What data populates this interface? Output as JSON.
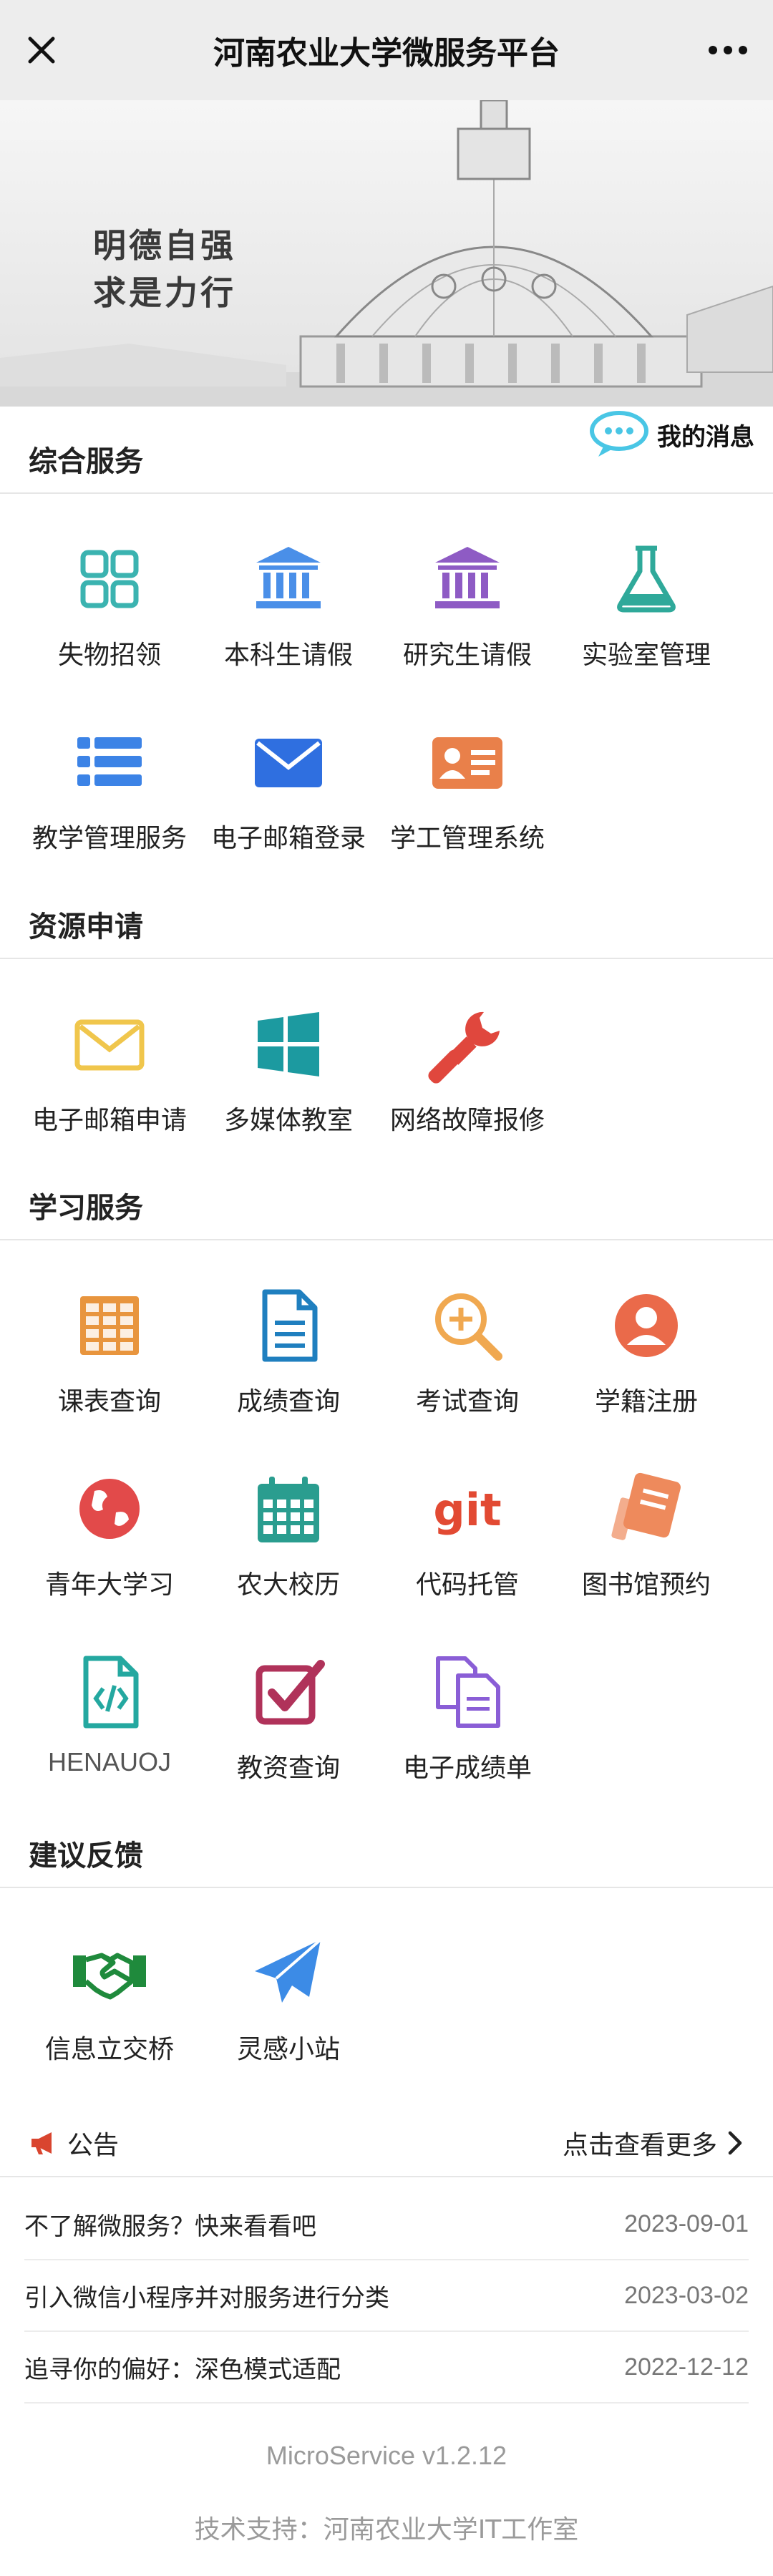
{
  "header": {
    "title": "河南农业大学微服务平台"
  },
  "banner": {
    "motto_line1": "明德自强",
    "motto_line2": "求是力行"
  },
  "messages": {
    "label": "我的消息"
  },
  "sections": {
    "general": {
      "title": "综合服务",
      "items": [
        {
          "label": "失物招领",
          "icon": "grid-icon",
          "color": "#3bb3b0"
        },
        {
          "label": "本科生请假",
          "icon": "building-icon",
          "color": "#4a8fe8"
        },
        {
          "label": "研究生请假",
          "icon": "building-icon",
          "color": "#8e5bc4"
        },
        {
          "label": "实验室管理",
          "icon": "flask-icon",
          "color": "#2fa99a"
        },
        {
          "label": "教学管理服务",
          "icon": "list-icon",
          "color": "#3c83e6"
        },
        {
          "label": "电子邮箱登录",
          "icon": "envelope-icon",
          "color": "#2f6fe0"
        },
        {
          "label": "学工管理系统",
          "icon": "id-card-icon",
          "color": "#e9804a"
        }
      ]
    },
    "resources": {
      "title": "资源申请",
      "items": [
        {
          "label": "电子邮箱申请",
          "icon": "envelope-outline-icon",
          "color": "#f0c64c"
        },
        {
          "label": "多媒体教室",
          "icon": "windows-icon",
          "color": "#1c9aa0"
        },
        {
          "label": "网络故障报修",
          "icon": "wrench-icon",
          "color": "#e0473d"
        }
      ]
    },
    "study": {
      "title": "学习服务",
      "items": [
        {
          "label": "课表查询",
          "icon": "table-icon",
          "color": "#e8953e"
        },
        {
          "label": "成绩查询",
          "icon": "document-icon",
          "color": "#1f7fbf"
        },
        {
          "label": "考试查询",
          "icon": "zoom-in-icon",
          "color": "#f0a850"
        },
        {
          "label": "学籍注册",
          "icon": "user-circle-icon",
          "color": "#ea6a4a"
        },
        {
          "label": "青年大学习",
          "icon": "globe-icon",
          "color": "#e24a4a"
        },
        {
          "label": "农大校历",
          "icon": "calendar-icon",
          "color": "#2a9d8f"
        },
        {
          "label": "代码托管",
          "icon": "git-icon",
          "color": "#e24a33"
        },
        {
          "label": "图书馆预约",
          "icon": "book-icon",
          "color": "#ee8a5c"
        },
        {
          "label": "HENAUOJ",
          "icon": "code-file-icon",
          "color": "#24a8a0"
        },
        {
          "label": "教资查询",
          "icon": "checkbox-icon",
          "color": "#b0325a"
        },
        {
          "label": "电子成绩单",
          "icon": "copy-files-icon",
          "color": "#8a5ed6"
        }
      ]
    },
    "feedback": {
      "title": "建议反馈",
      "items": [
        {
          "label": "信息立交桥",
          "icon": "handshake-icon",
          "color": "#1f8a3c"
        },
        {
          "label": "灵感小站",
          "icon": "paper-plane-icon",
          "color": "#3c8be6"
        }
      ]
    }
  },
  "notice": {
    "title": "公告",
    "more": "点击查看更多",
    "items": [
      {
        "text": "不了解微服务？快来看看吧",
        "date": "2023-09-01"
      },
      {
        "text": "引入微信小程序并对服务进行分类",
        "date": "2023-03-02"
      },
      {
        "text": "追寻你的偏好：深色模式适配",
        "date": "2022-12-12"
      }
    ]
  },
  "footer": {
    "version": "MicroService v1.2.12",
    "support": "技术支持：河南农业大学IT工作室"
  }
}
